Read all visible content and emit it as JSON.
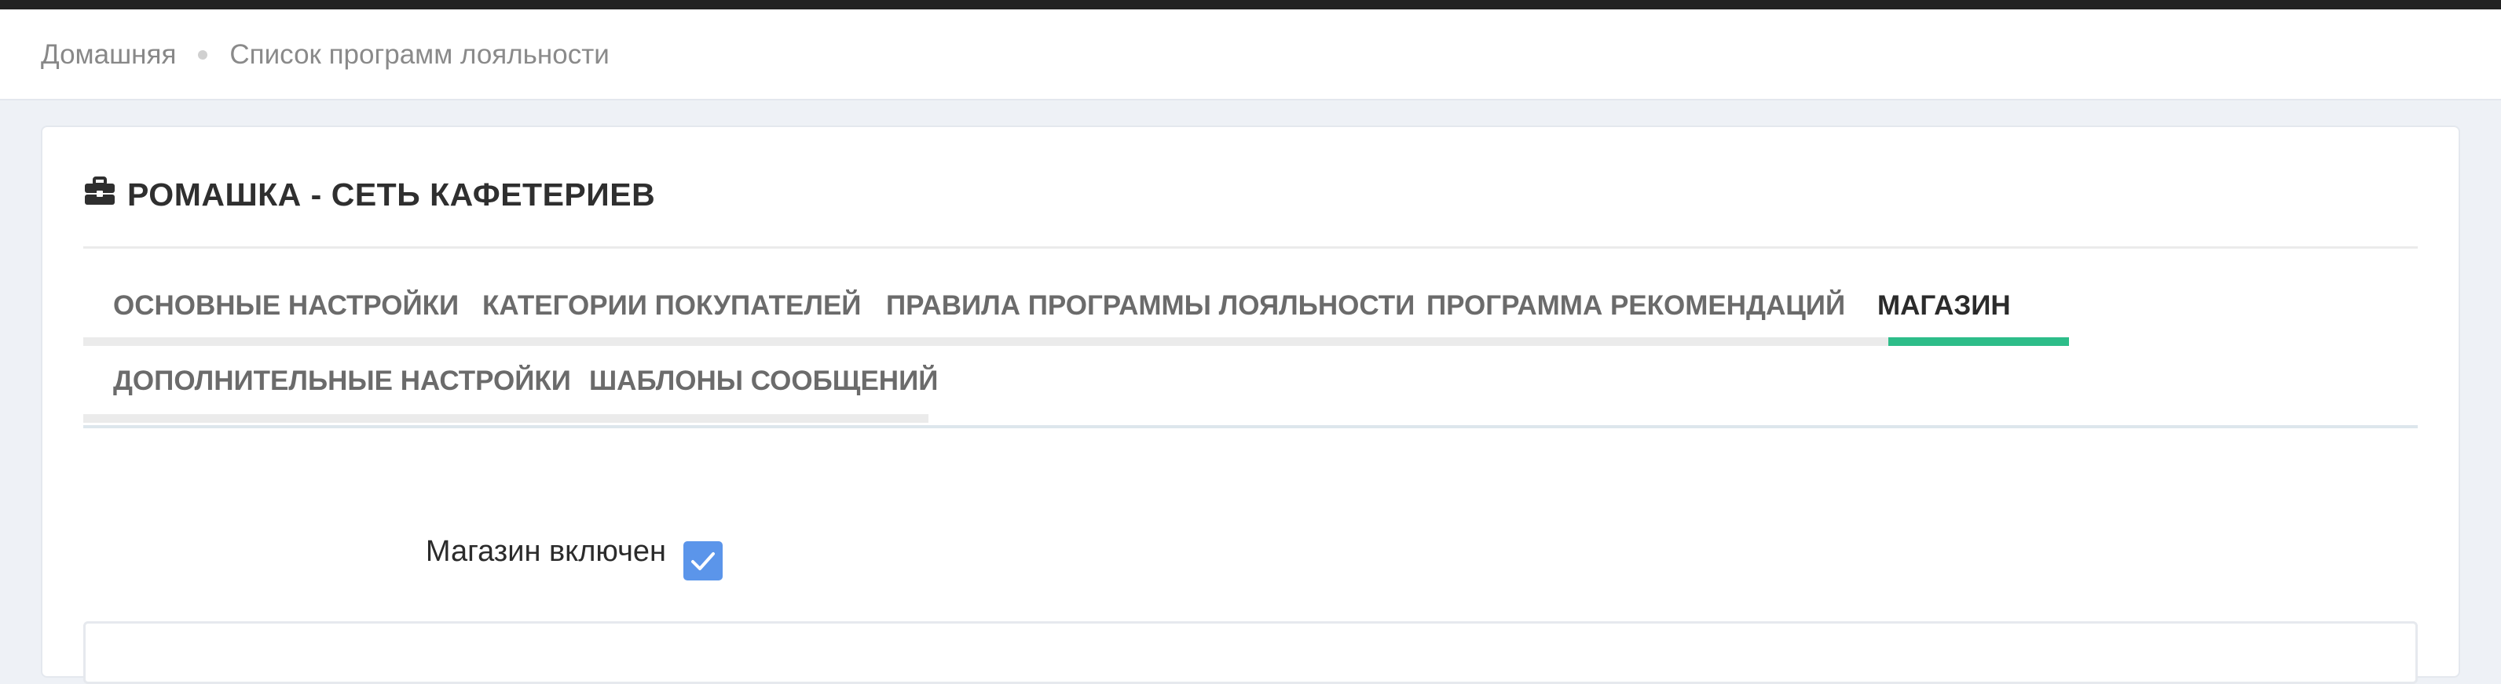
{
  "breadcrumb": {
    "home": "Домашняя",
    "current": "Список программ лояльности"
  },
  "card": {
    "icon": "briefcase-icon",
    "title": "РОМАШКА - СЕТЬ КАФЕТЕРИЕВ"
  },
  "tabs": [
    {
      "label": "ОСНОВНЫЕ НАСТРОЙКИ",
      "active": false
    },
    {
      "label": "КАТЕГОРИИ ПОКУПАТЕЛЕЙ",
      "active": false
    },
    {
      "label": "ПРАВИЛА ПРОГРАММЫ ЛОЯЛЬНОСТИ",
      "active": false
    },
    {
      "label": "ПРОГРАММА РЕКОМЕНДАЦИЙ",
      "active": false
    },
    {
      "label": "МАГАЗИН",
      "active": true
    },
    {
      "label": "ДОПОЛНИТЕЛЬНЫЕ НАСТРОЙКИ",
      "active": false
    },
    {
      "label": "ШАБЛОНЫ СООБЩЕНИЙ",
      "active": false
    }
  ],
  "form": {
    "shop_enabled_label": "Магазин включен",
    "shop_enabled_checked": true
  },
  "colors": {
    "active_tab_indicator": "#2dbd89",
    "checkbox": "#5b95ea",
    "page_background": "#eef1f6"
  }
}
